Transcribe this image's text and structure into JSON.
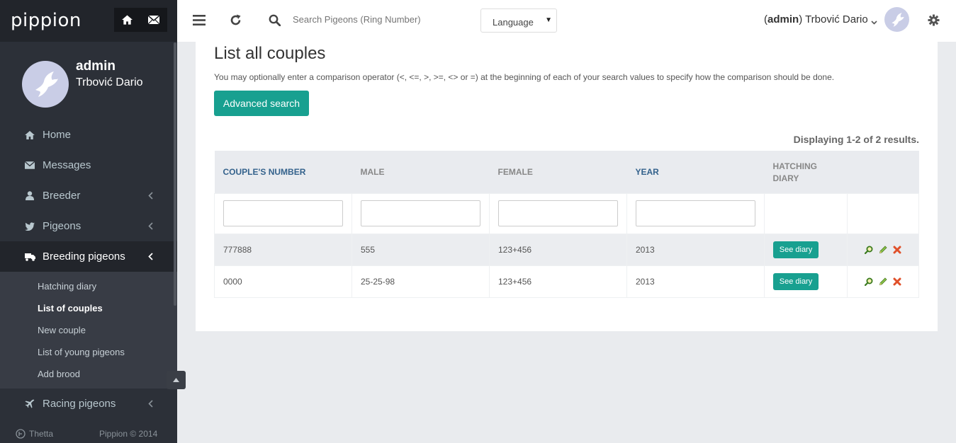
{
  "brand": {
    "name": "pippion"
  },
  "user": {
    "username": "admin",
    "full_name": "Trbović Dario"
  },
  "sidebar": {
    "items": [
      {
        "label": "Home",
        "icon": "home-icon"
      },
      {
        "label": "Messages",
        "icon": "envelope-icon"
      },
      {
        "label": "Breeder",
        "icon": "user-icon"
      },
      {
        "label": "Pigeons",
        "icon": "twitter-bird-icon"
      },
      {
        "label": "Breeding pigeons",
        "icon": "truck-icon"
      }
    ],
    "submenu": [
      {
        "label": "Hatching diary"
      },
      {
        "label": "List of couples"
      },
      {
        "label": "New couple"
      },
      {
        "label": "List of young pigeons"
      },
      {
        "label": "Add brood"
      }
    ],
    "after": [
      {
        "label": "Racing pigeons",
        "icon": "plane-icon"
      }
    ],
    "footer": {
      "company": "Thetta",
      "copyright": "Pippion © 2014"
    }
  },
  "header": {
    "search_placeholder": "Search Pigeons (Ring Number)",
    "language_label": "Language",
    "caret": "▼",
    "user_prefix_open": "(",
    "user_bold": "admin",
    "user_suffix": ") Trbović Dario"
  },
  "page": {
    "title": "List all couples",
    "hint": "You may optionally enter a comparison operator (<, <=, >, >=, <> or =) at the beginning of each of your search values to specify how the comparison should be done.",
    "advanced_search": "Advanced search",
    "summary": "Displaying 1-2 of 2 results."
  },
  "table": {
    "headers": {
      "couples_number": "COUPLE'S NUMBER",
      "male": "MALE",
      "female": "FEMALE",
      "year": "YEAR",
      "hatching_1": "HATCHING",
      "hatching_2": "DIARY"
    },
    "rows": [
      {
        "number": "777888",
        "male": "555",
        "female": "123+456",
        "year": "2013",
        "diary": "See diary"
      },
      {
        "number": "0000",
        "male": "25-25-98",
        "female": "123+456",
        "year": "2013",
        "diary": "See diary"
      }
    ]
  },
  "colors": {
    "accent": "#18a090",
    "sidebar": "#2c3038",
    "link": "#34628c"
  }
}
